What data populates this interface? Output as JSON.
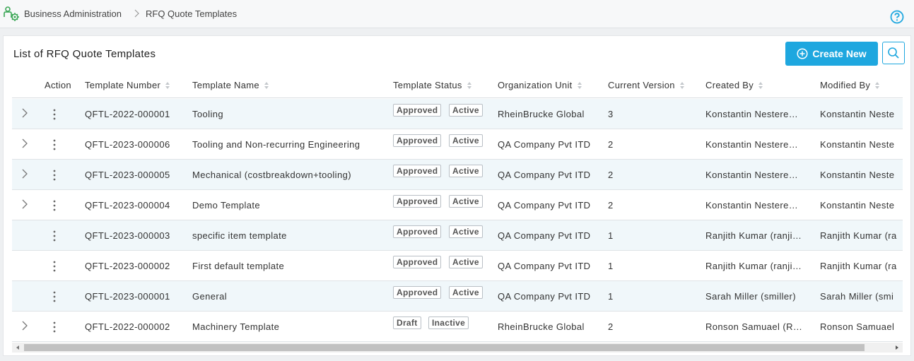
{
  "breadcrumb": {
    "items": [
      "Business Administration",
      "RFQ Quote Templates"
    ]
  },
  "icons": {
    "app": "gear-people-icon",
    "separator": "chevron-right-icon",
    "help": "help-circle-icon",
    "create": "plus-circle-icon",
    "search": "search-icon",
    "expand": "chevron-right-icon",
    "actions": "kebab-menu-icon"
  },
  "panel": {
    "title": "List of RFQ Quote Templates",
    "create_label": "Create New"
  },
  "colors": {
    "accent": "#1ea7df",
    "row_alt": "#f0f7fa"
  },
  "table": {
    "columns": [
      "Action",
      "Template Number",
      "Template Name",
      "Template Status",
      "Organization Unit",
      "Current Version",
      "Created By",
      "Modified By"
    ],
    "rows": [
      {
        "number": "QFTL-2022-000001",
        "name": "Tooling",
        "status": "Approved",
        "state": "Active",
        "org": "RheinBrucke Global",
        "version": "3",
        "created": "Konstantin Nestere…",
        "modified": "Konstantin Neste",
        "expandable": true
      },
      {
        "number": "QFTL-2023-000006",
        "name": "Tooling and Non-recurring Engineering",
        "status": "Approved",
        "state": "Active",
        "org": "QA Company Pvt ITD",
        "version": "2",
        "created": "Konstantin Nestere…",
        "modified": "Konstantin Neste",
        "expandable": true
      },
      {
        "number": "QFTL-2023-000005",
        "name": "Mechanical (costbreakdown+tooling)",
        "status": "Approved",
        "state": "Active",
        "org": "QA Company Pvt ITD",
        "version": "2",
        "created": "Konstantin Nestere…",
        "modified": "Konstantin Neste",
        "expandable": true
      },
      {
        "number": "QFTL-2023-000004",
        "name": "Demo Template",
        "status": "Approved",
        "state": "Active",
        "org": "QA Company Pvt ITD",
        "version": "2",
        "created": "Konstantin Nestere…",
        "modified": "Konstantin Neste",
        "expandable": true
      },
      {
        "number": "QFTL-2023-000003",
        "name": "specific item template",
        "status": "Approved",
        "state": "Active",
        "org": "QA Company Pvt ITD",
        "version": "1",
        "created": "Ranjith Kumar (ranji…",
        "modified": "Ranjith Kumar (ra",
        "expandable": false
      },
      {
        "number": "QFTL-2023-000002",
        "name": "First default template",
        "status": "Approved",
        "state": "Active",
        "org": "QA Company Pvt ITD",
        "version": "1",
        "created": "Ranjith Kumar (ranji…",
        "modified": "Ranjith Kumar (ra",
        "expandable": false
      },
      {
        "number": "QFTL-2023-000001",
        "name": "General",
        "status": "Approved",
        "state": "Active",
        "org": "QA Company Pvt ITD",
        "version": "1",
        "created": "Sarah Miller (smiller)",
        "modified": "Sarah Miller (smi",
        "expandable": false
      },
      {
        "number": "QFTL-2022-000002",
        "name": "Machinery Template",
        "status": "Draft",
        "state": "Inactive",
        "org": "RheinBrucke Global",
        "version": "2",
        "created": "Ronson Samuael (R…",
        "modified": "Ronson Samuael",
        "expandable": true
      }
    ]
  }
}
